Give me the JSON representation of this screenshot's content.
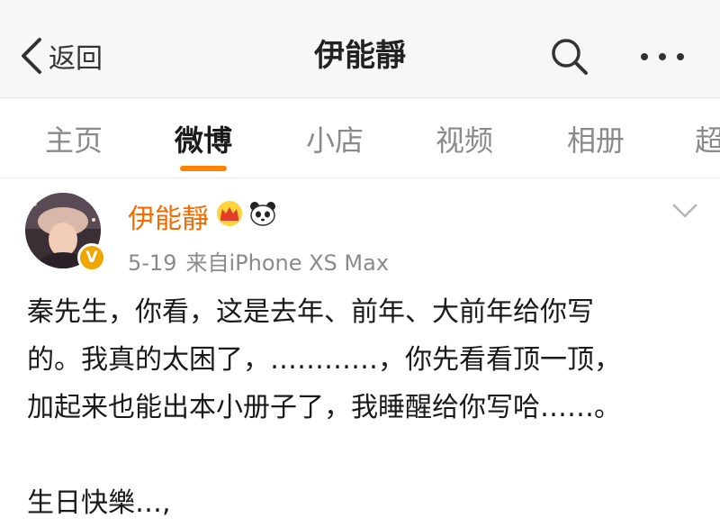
{
  "header": {
    "back_label": "返回",
    "title": "伊能靜",
    "icons": [
      "chevron-left-icon",
      "search-icon",
      "more-icon"
    ]
  },
  "tabs": [
    {
      "label": "主页",
      "active": false
    },
    {
      "label": "微博",
      "active": true
    },
    {
      "label": "小店",
      "active": false
    },
    {
      "label": "视频",
      "active": false
    },
    {
      "label": "相册",
      "active": false
    },
    {
      "label": "超",
      "active": false
    }
  ],
  "accent_color": "#ff8200",
  "post": {
    "author": "伊能靜",
    "badges": [
      "crown-icon",
      "panda-icon",
      "verified-icon"
    ],
    "date": "5-19",
    "source": "来自iPhone XS Max",
    "text_lines": [
      "秦先生，你看，这是去年、前年、大前年给你写",
      "的。我真的太困了，…………，你先看看顶一顶，",
      "加起来也能出本小册子了，我睡醒给你写哈……。",
      "",
      "生日快樂…,"
    ],
    "verified_letter": "V"
  }
}
